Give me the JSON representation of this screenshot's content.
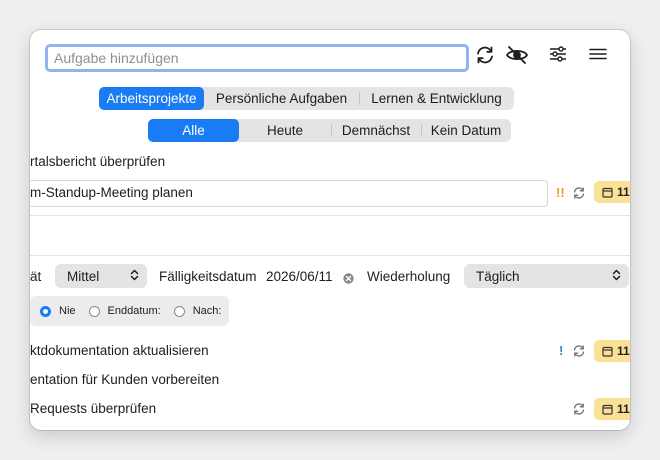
{
  "search": {
    "placeholder": "Aufgabe hinzufügen"
  },
  "toolbar": {
    "sync_icon": "sync-icon",
    "hide_icon": "eye-slash-icon",
    "filter_icon": "sliders-icon",
    "menu_icon": "hamburger-menu-icon"
  },
  "projects": {
    "tabs": [
      {
        "label": "Arbeitsprojekte",
        "active": true
      },
      {
        "label": "Persönliche Aufgaben",
        "active": false
      },
      {
        "label": "Lernen & Entwicklung",
        "active": false
      }
    ]
  },
  "filters": {
    "tabs": [
      {
        "label": "Alle",
        "active": true
      },
      {
        "label": "Heute",
        "active": false
      },
      {
        "label": "Demnächst",
        "active": false
      },
      {
        "label": "Kein Datum",
        "active": false
      }
    ]
  },
  "tasks": [
    {
      "title": "rtalsbericht überprüfen"
    },
    {
      "title": "m-Standup-Meeting planen",
      "priority": "!!",
      "repeat": true,
      "date": "11."
    }
  ],
  "editor": {
    "priority_label": "ät",
    "priority_value": "Mittel",
    "due_label": "Fälligkeitsdatum",
    "due_value": "2026/06/11",
    "repeat_label": "Wiederholung",
    "repeat_value": "Täglich",
    "end_options": [
      {
        "label": "Nie",
        "selected": true
      },
      {
        "label": "Enddatum:",
        "selected": false
      },
      {
        "label": "Nach:",
        "selected": false
      }
    ]
  },
  "more_tasks": [
    {
      "title": "ktdokumentation aktualisieren",
      "priority": "!",
      "repeat": true,
      "date": "11."
    },
    {
      "title": "entation für Kunden vorbereiten"
    },
    {
      "title": "Requests überprüfen",
      "repeat": true,
      "date": "11."
    }
  ],
  "colors": {
    "accent": "#1a7cf5",
    "priority_high": "#e8a21c",
    "priority_medium": "#2a8cd6",
    "date_badge": "#fbe195"
  }
}
